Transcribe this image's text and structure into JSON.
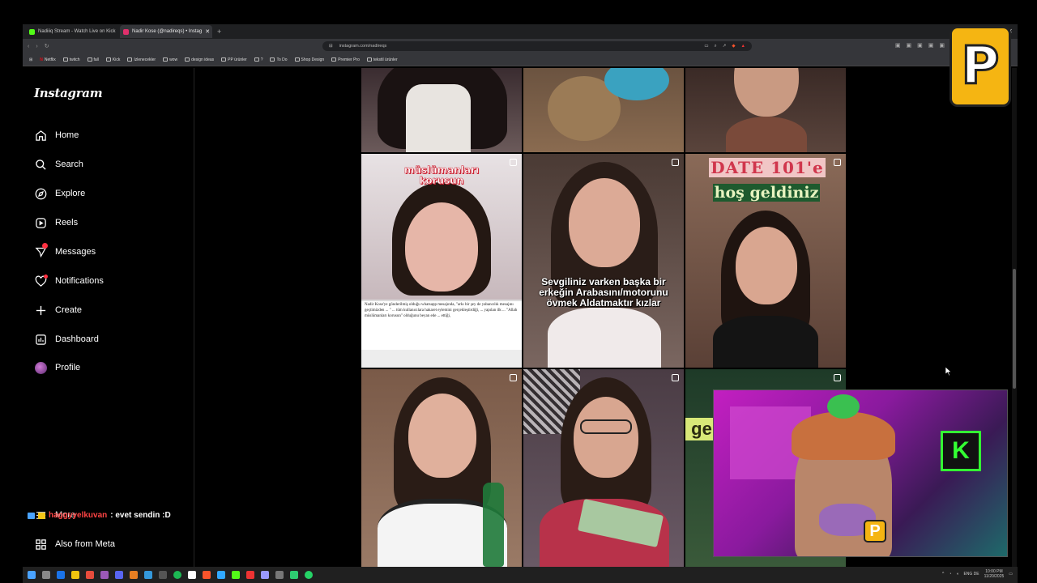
{
  "browser": {
    "tabs": [
      {
        "title": "Nadiiiq Stream - Watch Live on Kick",
        "color": "#53fc18"
      },
      {
        "title": "Nadir Kose (@nadireqs) • Instag",
        "color": "#e1306c"
      }
    ],
    "new_tab_label": "+",
    "url": "instagram.com/nadireqs",
    "bookmarks": [
      "Netflix",
      "twitch",
      "fall",
      "Kick",
      "Izlenecekler",
      "wow",
      "design ideas",
      "PP ürünler",
      "?",
      "To Do",
      "Shop Design",
      "Premier Pro",
      "tekstil ürünler"
    ]
  },
  "sidebar": {
    "logo": "Instagram",
    "items": [
      {
        "label": "Home",
        "icon": "home-icon"
      },
      {
        "label": "Search",
        "icon": "search-icon"
      },
      {
        "label": "Explore",
        "icon": "compass-icon"
      },
      {
        "label": "Reels",
        "icon": "reels-icon"
      },
      {
        "label": "Messages",
        "icon": "messages-icon"
      },
      {
        "label": "Notifications",
        "icon": "heart-icon"
      },
      {
        "label": "Create",
        "icon": "plus-icon"
      },
      {
        "label": "Dashboard",
        "icon": "dashboard-icon"
      },
      {
        "label": "Profile",
        "icon": "avatar"
      }
    ],
    "more": "More",
    "also_from_meta": "Also from Meta"
  },
  "chat": {
    "username": "haggyyelkuvan",
    "message": ": evet sendin :D"
  },
  "grid": {
    "tiles": [
      {
        "caption": ""
      },
      {
        "caption": ""
      },
      {
        "caption": ""
      },
      {
        "caption_top": "müslümanları korusun",
        "caption_body": "Nadir Kose'ye gönderilmiş olduğu whatsapp mesajında, \"arkı bir şey de yabancılık mesajını geçtimizden ... \" ... tüm kullanıcılara hakaret eylemini gerçekleştirdiği, ... yapılan ilk ... \"Allah müslümanları korusun\" olduğunu beyan ede ... ettiği,"
      },
      {
        "caption": "Sevgiliniz varken başka bir erkeğin Arabasını/motorunu övmek Aldatmaktır kızlar"
      },
      {
        "caption_line1": "DATE 101'e",
        "caption_line2": "hoş geldiniz"
      },
      {
        "caption": ""
      },
      {
        "caption": ""
      },
      {
        "caption": "ge"
      }
    ]
  },
  "taskbar": {
    "lang": "ENG DE",
    "time": "10:00 PM",
    "date": "11/20/2025"
  }
}
